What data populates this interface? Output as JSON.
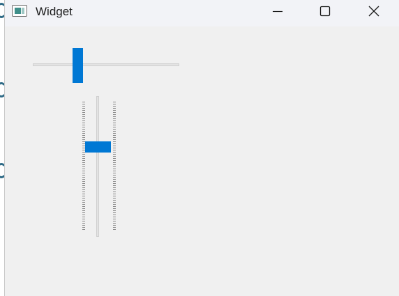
{
  "window": {
    "title": "Widget",
    "icon": "window-app-icon",
    "controls": {
      "minimize_icon": "minimize-icon",
      "maximize_icon": "maximize-icon",
      "close_icon": "close-icon"
    }
  },
  "content": {
    "horizontal_slider": {
      "orientation": "horizontal",
      "value_fraction": 0.3,
      "handle_color": "#0078d4"
    },
    "vertical_slider": {
      "orientation": "vertical",
      "value_fraction": 0.65,
      "tick_marks": "both-sides",
      "handle_color": "#0078d4"
    }
  },
  "colors": {
    "accent": "#0078d4",
    "window_background": "#f0f0f0",
    "titlebar_background": "#f2f3f7"
  }
}
